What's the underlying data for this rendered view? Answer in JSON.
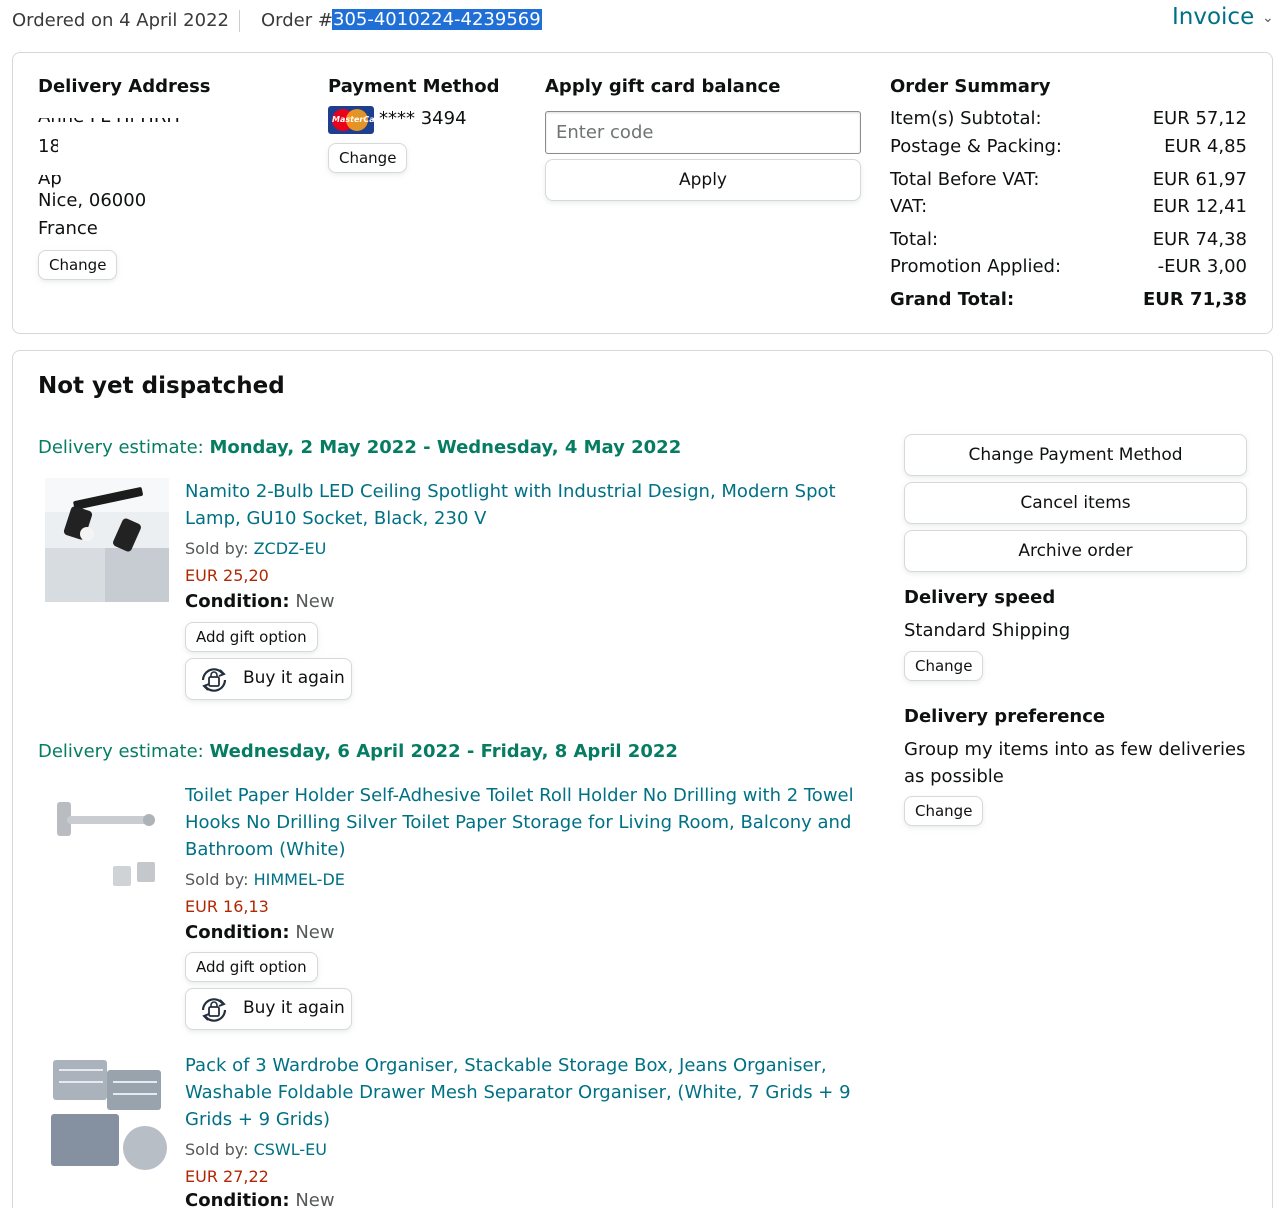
{
  "header": {
    "ordered_on": "Ordered on 4 April 2022",
    "order_label": "Order #",
    "order_number": "305-4010224-4239569",
    "invoice_label": "Invoice",
    "invoice_chevron": "chevron-down-icon"
  },
  "delivery_address": {
    "title": "Delivery Address",
    "line1": "Anne FL Hi HRH",
    "line2": "18 —— —",
    "line3": "Ap",
    "line4": "Nice, 06000",
    "line5": "France",
    "change": "Change"
  },
  "payment": {
    "title": "Payment Method",
    "card_logo_text": "MasterCard",
    "card_number": "**** 3494",
    "change": "Change"
  },
  "gift_card": {
    "title": "Apply gift card balance",
    "placeholder": "Enter code",
    "apply": "Apply"
  },
  "order_summary": {
    "title": "Order Summary",
    "rows": [
      {
        "label": "Item(s) Subtotal:",
        "value": "EUR 57,12"
      },
      {
        "label": "Postage & Packing:",
        "value": "EUR 4,85"
      },
      {
        "label": "Total Before VAT:",
        "value": "EUR 61,97"
      },
      {
        "label": "VAT:",
        "value": "EUR 12,41"
      },
      {
        "label": "Total:",
        "value": "EUR 74,38"
      },
      {
        "label": "Promotion Applied:",
        "value": "-EUR 3,00"
      },
      {
        "label": "Grand Total:",
        "value": "EUR 71,38"
      }
    ]
  },
  "shipment": {
    "status": "Not yet dispatched",
    "estimate_label": "Delivery estimate:",
    "groups": [
      {
        "estimate": "Monday, 2 May 2022 - Wednesday, 4 May 2022",
        "items": [
          {
            "title": "Namito 2-Bulb LED Ceiling Spotlight with Industrial Design, Modern Spot Lamp, GU10 Socket, Black, 230 V",
            "sold_by_label": "Sold by:",
            "seller": "ZCDZ-EU",
            "price": "EUR 25,20",
            "condition_label": "Condition:",
            "condition": "New",
            "gift_option": "Add gift option",
            "buy_again": "Buy it again"
          }
        ]
      },
      {
        "estimate": "Wednesday, 6 April 2022 - Friday, 8 April 2022",
        "items": [
          {
            "title": "Toilet Paper Holder Self-Adhesive Toilet Roll Holder No Drilling with 2 Towel Hooks No Drilling Silver Toilet Paper Storage for Living Room, Balcony and Bathroom (White)",
            "sold_by_label": "Sold by:",
            "seller": "HIMMEL-DE",
            "price": "EUR 16,13",
            "condition_label": "Condition:",
            "condition": "New",
            "gift_option": "Add gift option",
            "buy_again": "Buy it again"
          },
          {
            "title": "Pack of 3 Wardrobe Organiser, Stackable Storage Box, Jeans Organiser, Washable Foldable Drawer Mesh Separator Organiser, (White, 7 Grids + 9 Grids + 9 Grids)",
            "sold_by_label": "Sold by:",
            "seller": "CSWL-EU",
            "price": "EUR 27,22",
            "condition_label": "Condition:",
            "condition": "New"
          }
        ]
      }
    ]
  },
  "actions": {
    "change_payment": "Change Payment Method",
    "cancel_items": "Cancel items",
    "archive_order": "Archive order"
  },
  "delivery_speed": {
    "title": "Delivery speed",
    "value": "Standard Shipping",
    "change": "Change"
  },
  "delivery_preference": {
    "title": "Delivery preference",
    "value_line1": "Group my items into as few deliveries",
    "value_line2": "as possible",
    "change": "Change"
  },
  "colors": {
    "link": "#007185",
    "price": "#b12704",
    "estimate": "#067d62",
    "selection": "#1f6fd6"
  }
}
